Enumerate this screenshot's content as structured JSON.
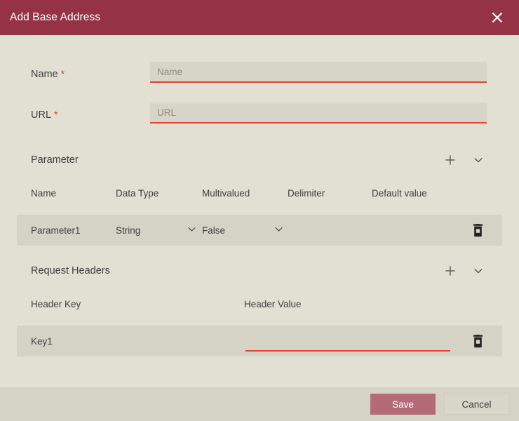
{
  "dialog": {
    "title": "Add Base Address",
    "close_icon": "close-icon"
  },
  "form": {
    "name": {
      "label": "Name",
      "required_marker": "*",
      "placeholder": "Name",
      "value": ""
    },
    "url": {
      "label": "URL",
      "required_marker": "*",
      "placeholder": "URL",
      "value": ""
    }
  },
  "parameter_section": {
    "title": "Parameter",
    "add_icon": "plus-icon",
    "collapse_icon": "chevron-down-icon",
    "columns": [
      "Name",
      "Data Type",
      "Multivalued",
      "Delimiter",
      "Default value"
    ],
    "rows": [
      {
        "name": "Parameter1",
        "data_type": "String",
        "multivalued": "False",
        "delimiter": "",
        "default_value": "",
        "delete_icon": "trash-icon"
      }
    ]
  },
  "request_headers_section": {
    "title": "Request Headers",
    "add_icon": "plus-icon",
    "collapse_icon": "chevron-down-icon",
    "columns": [
      "Header Key",
      "Header Value"
    ],
    "rows": [
      {
        "header_key": "Key1",
        "header_value": "",
        "header_value_placeholder": "",
        "delete_icon": "trash-icon"
      }
    ]
  },
  "footer": {
    "save_label": "Save",
    "cancel_label": "Cancel"
  },
  "colors": {
    "titlebar": "#953245",
    "body": "#e2e0d3",
    "row": "#d5d3c6",
    "input": "#d7d5c8",
    "accent_underline": "#e8412e",
    "required_star": "#d9372b",
    "save_button": "#b56a78"
  }
}
